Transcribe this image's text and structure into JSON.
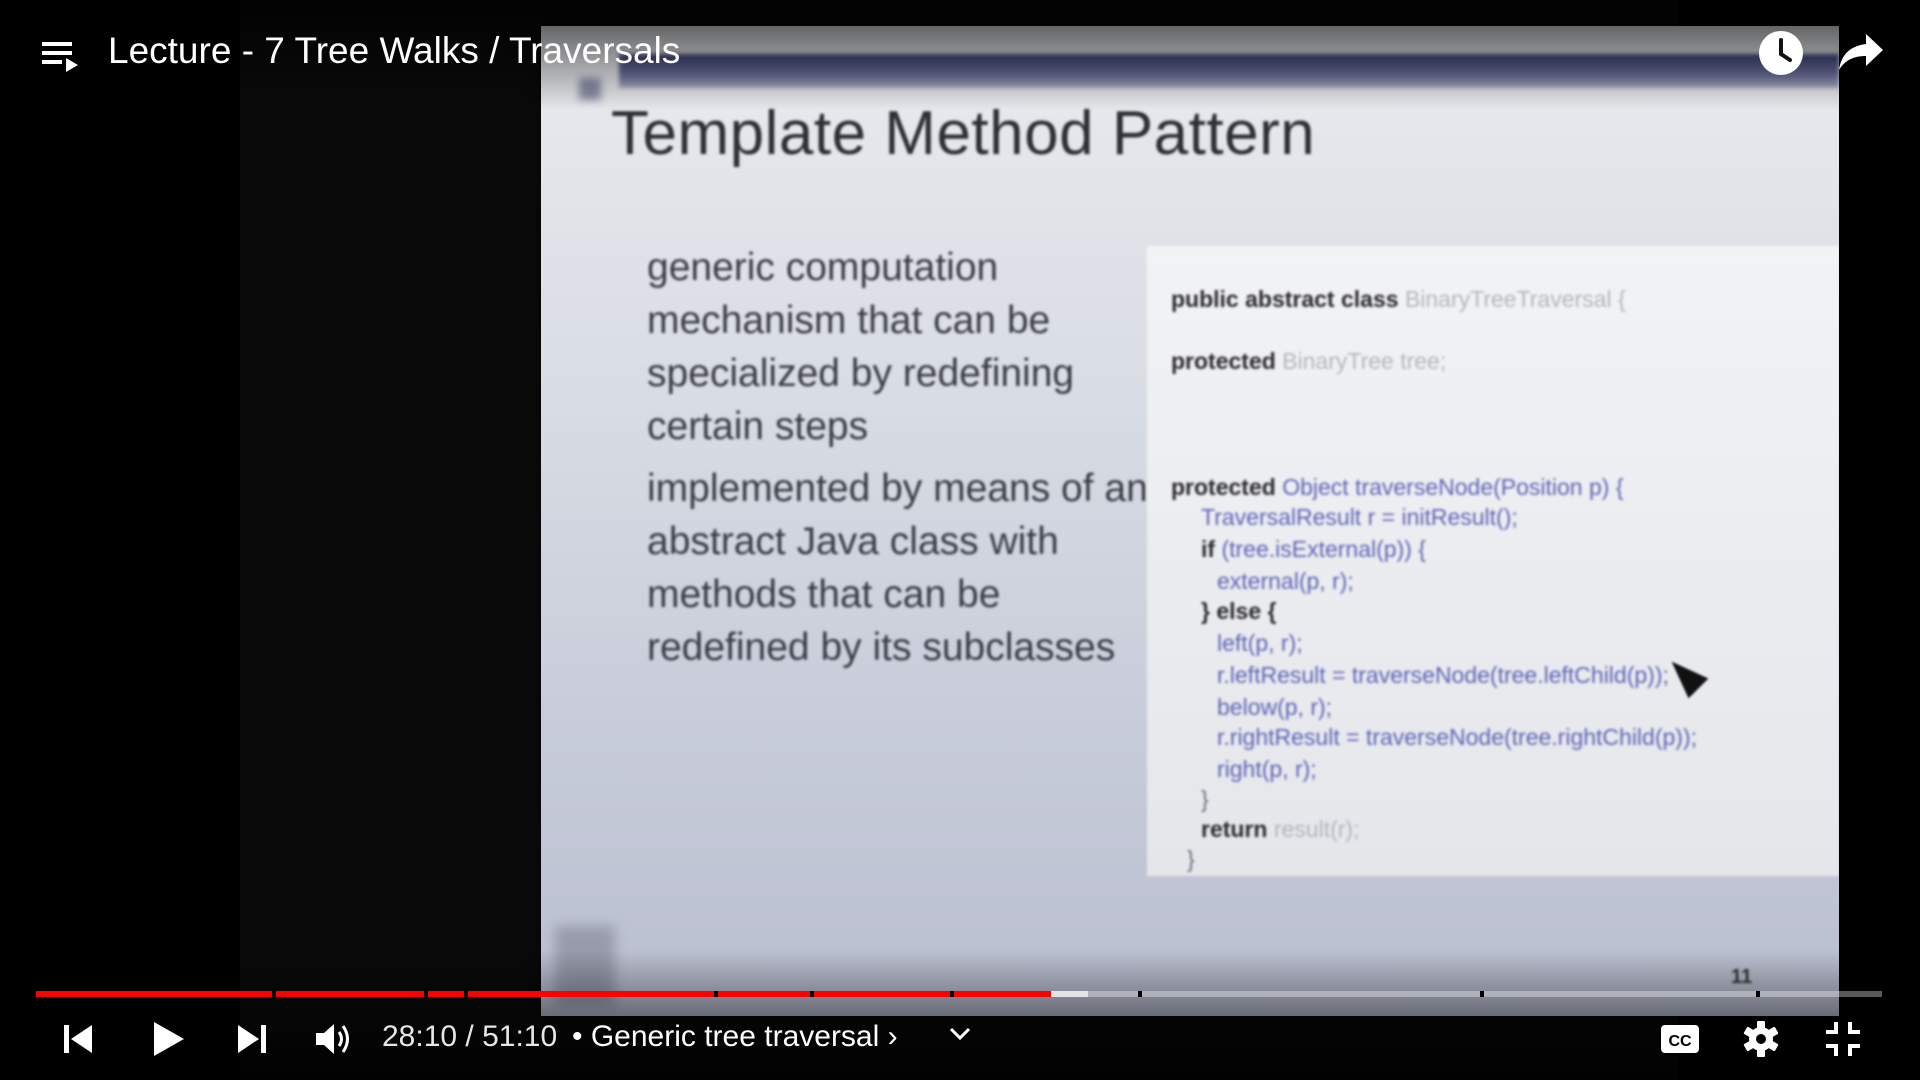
{
  "header": {
    "title": "Lecture - 7 Tree Walks / Traversals",
    "playlist_icon": "playlist-icon",
    "watch_later_icon": "clock-icon",
    "share_icon": "share-icon"
  },
  "slide": {
    "title": "Template Method Pattern",
    "bullets": [
      "generic computation mechanism that can be specialized by redefining certain steps",
      "implemented by means of an abstract Java class with methods that can be redefined by its subclasses"
    ],
    "code": {
      "class_decl_kw": "public abstract class",
      "class_name": "BinaryTreeTraversal {",
      "field_kw": "protected",
      "field_decl": "BinaryTree tree;",
      "method_kw": "protected",
      "method_sig": "Object traverseNode(Position p) {",
      "line_init": "TraversalResult r = initResult();",
      "if_kw": "if",
      "if_cond": "(tree.isExternal(p)) {",
      "line_external": "external(p, r);",
      "else_kw": "} else {",
      "line_left": "left(p, r);",
      "line_leftres": "r.leftResult = traverseNode(tree.leftChild(p));",
      "line_below": "below(p, r);",
      "line_rightres": "r.rightResult = traverseNode(tree.rightChild(p));",
      "line_right": "right(p, r);",
      "close1": "}",
      "return_kw": "return",
      "return_val": "result(r);",
      "close2": "}"
    },
    "page_number": "11"
  },
  "player": {
    "current_time": "28:10",
    "separator": " / ",
    "duration": "51:10",
    "chapter": "• Generic tree traversal",
    "chapter_chevron": "›",
    "progress_played_fraction": 0.55,
    "progress_buffered_fraction": 0.57,
    "accent_color": "#ff0000",
    "icons": {
      "previous": "skip-previous-icon",
      "play": "play-icon",
      "next": "skip-next-icon",
      "volume": "volume-icon",
      "chapters": "chevron-down-icon",
      "captions": "cc-icon",
      "settings": "gear-icon",
      "exit_fullscreen": "exit-fullscreen-icon"
    }
  }
}
